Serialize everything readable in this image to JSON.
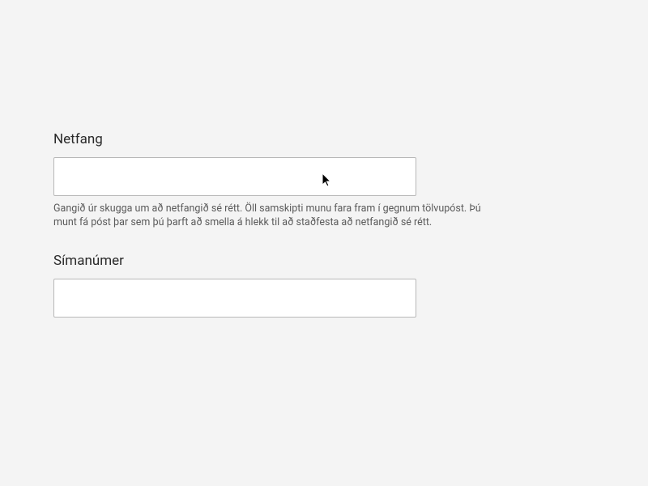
{
  "form": {
    "email": {
      "label": "Netfang",
      "value": "",
      "help": "Gangið úr skugga um að netfangið sé rétt. Öll samskipti munu fara fram í gegnum tölvupóst. Þú munt fá póst þar sem þú þarft að smella á hlekk til að staðfesta að netfangið sé rétt."
    },
    "phone": {
      "label": "Símanúmer",
      "value": ""
    }
  }
}
